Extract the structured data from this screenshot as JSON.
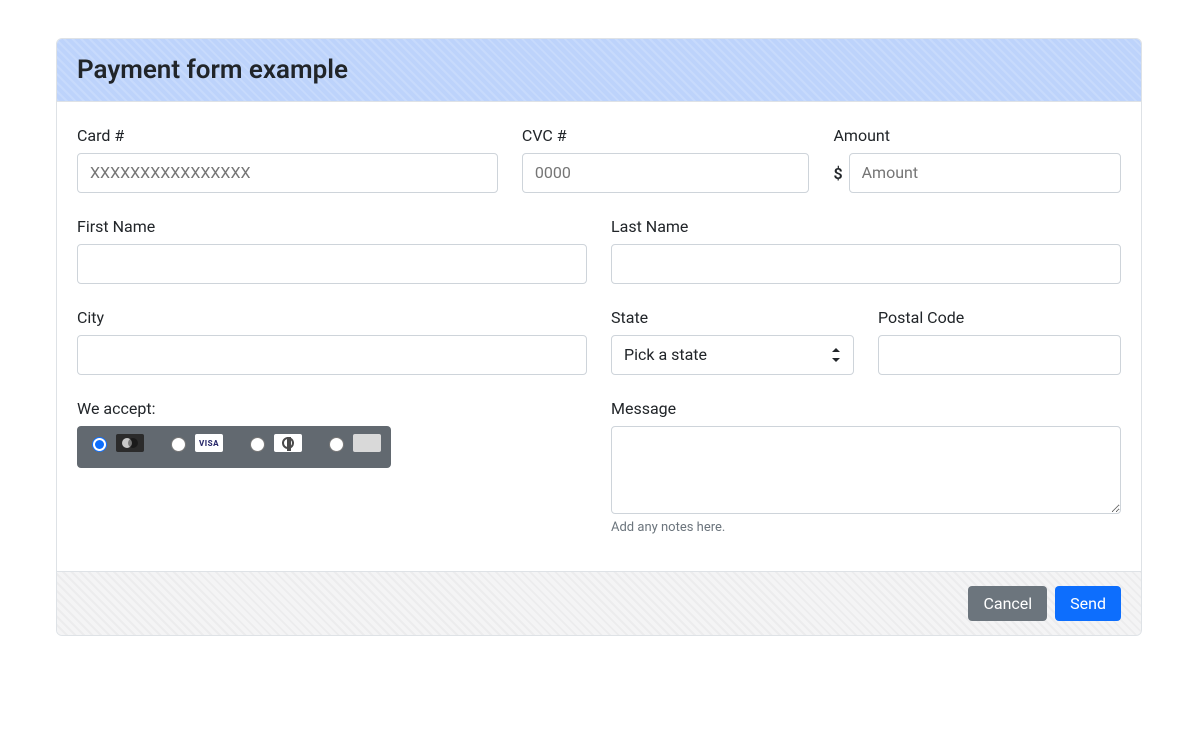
{
  "header": {
    "title": "Payment form example"
  },
  "fields": {
    "card_label": "Card #",
    "card_placeholder": "XXXXXXXXXXXXXXXX",
    "cvc_label": "CVC #",
    "cvc_placeholder": "0000",
    "amount_label": "Amount",
    "amount_prefix": "$",
    "amount_placeholder": "Amount",
    "first_name_label": "First Name",
    "last_name_label": "Last Name",
    "city_label": "City",
    "state_label": "State",
    "state_placeholder": "Pick a state",
    "postal_label": "Postal Code",
    "accept_label": "We accept:",
    "message_label": "Message",
    "message_help": "Add any notes here."
  },
  "card_types": {
    "options": [
      "mastercard",
      "visa",
      "diners",
      "amex"
    ],
    "selected": "mastercard"
  },
  "footer": {
    "cancel_label": "Cancel",
    "send_label": "Send"
  }
}
